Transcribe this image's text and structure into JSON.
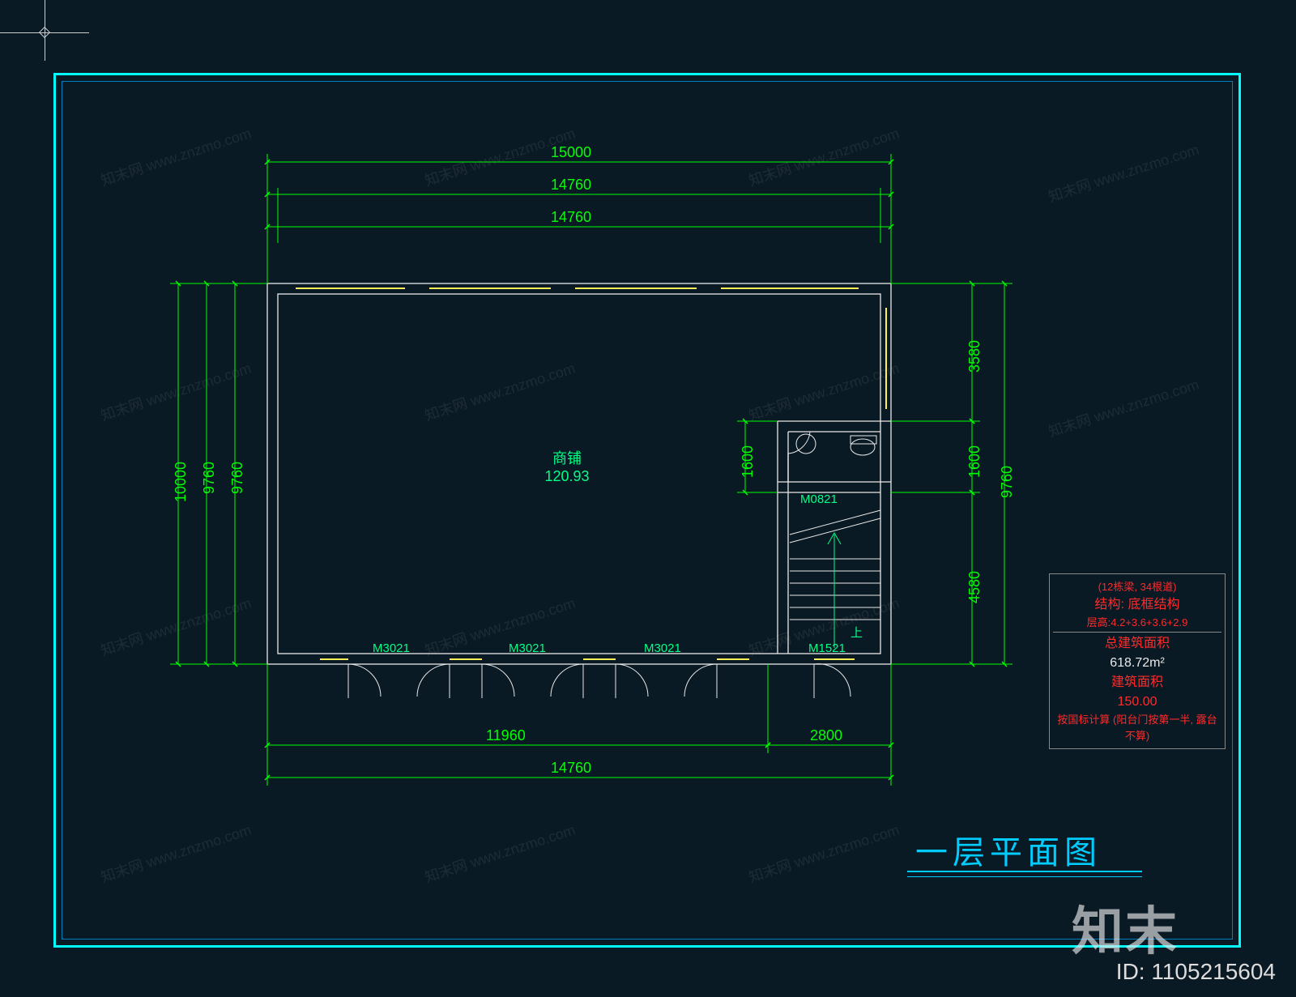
{
  "title": "一层平面图",
  "id_label": "ID: 1105215604",
  "watermark_big": "知末",
  "watermark_small": "知末网 www.znzmo.com",
  "room": {
    "name": "商铺",
    "area": "120.93"
  },
  "doors": {
    "m3021_1": "M3021",
    "m3021_2": "M3021",
    "m3021_3": "M3021",
    "m1521": "M1521",
    "m0821": "M0821"
  },
  "stair_label": "上",
  "dims": {
    "top_outer": "15000",
    "top_mid": "14760",
    "top_inner": "14760",
    "bottom_left": "11960",
    "bottom_right": "2800",
    "bottom_total": "14760",
    "left_outer": "10000",
    "left_mid": "9760",
    "left_inner": "9760",
    "right_top": "3580",
    "right_mid": "1600",
    "right_bot": "4580",
    "right_total": "9760",
    "inner_1600": "1600"
  },
  "info": {
    "line1": "(12栋梁, 34根道)",
    "line2": "结构: 底框结构",
    "line3": "层高:4.2+3.6+3.6+2.9",
    "total_area_label": "总建筑面积",
    "total_area_value": "618.72m²",
    "floor_area_label": "建筑面积",
    "floor_area_value": "150.00",
    "note": "按国标计算 (阳台门按第一半, 露台不算)"
  },
  "colors": {
    "bg": "#0a1a24",
    "cyan": "#00ffff",
    "green": "#00ff00",
    "yellow": "#ffee55",
    "red": "#ff2a2a",
    "white": "#e8e8e8"
  }
}
